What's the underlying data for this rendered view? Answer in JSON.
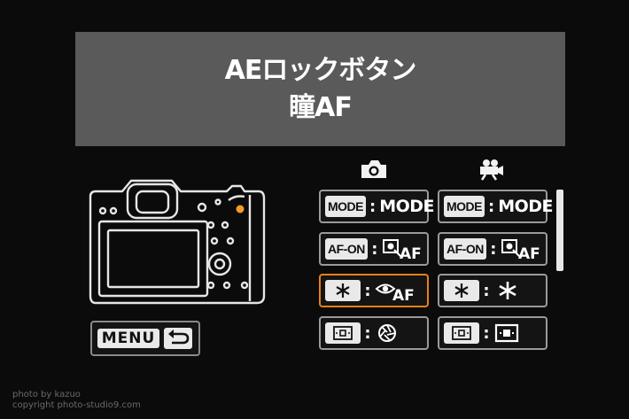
{
  "title": {
    "line1": "AEロックボタン",
    "line2": "瞳AF"
  },
  "menu_button": {
    "label": "MENU"
  },
  "columns": {
    "photo_icon": "camera-icon",
    "movie_icon": "movie-camera-icon"
  },
  "grid": {
    "rows": [
      {
        "button": "MODE",
        "photo_value": "MODE",
        "movie_value": "MODE"
      },
      {
        "button": "AF-ON",
        "photo_value_icon": "af-start-icon",
        "movie_value_icon": "af-start-icon"
      },
      {
        "button_icon": "ae-lock-icon",
        "photo_value_icon": "eye-af-icon",
        "movie_value_icon": "ae-lock-icon",
        "photo_selected": true
      },
      {
        "button_icon": "af-point-icon",
        "photo_value_icon": "aperture-icon",
        "movie_value_icon": "af-point-icon"
      }
    ]
  },
  "scroll": {
    "position": 0.0
  },
  "watermark": {
    "line1": "photo by kazuo",
    "line2": "copyright photo-studio9.com"
  },
  "colors": {
    "background": "#0b0b0b",
    "title_panel": "#5a5a5a",
    "selection": "#e8801a",
    "cell_border": "#9a9a9a",
    "badge": "#e9e9e9",
    "highlight_dot": "#f39a2a"
  }
}
